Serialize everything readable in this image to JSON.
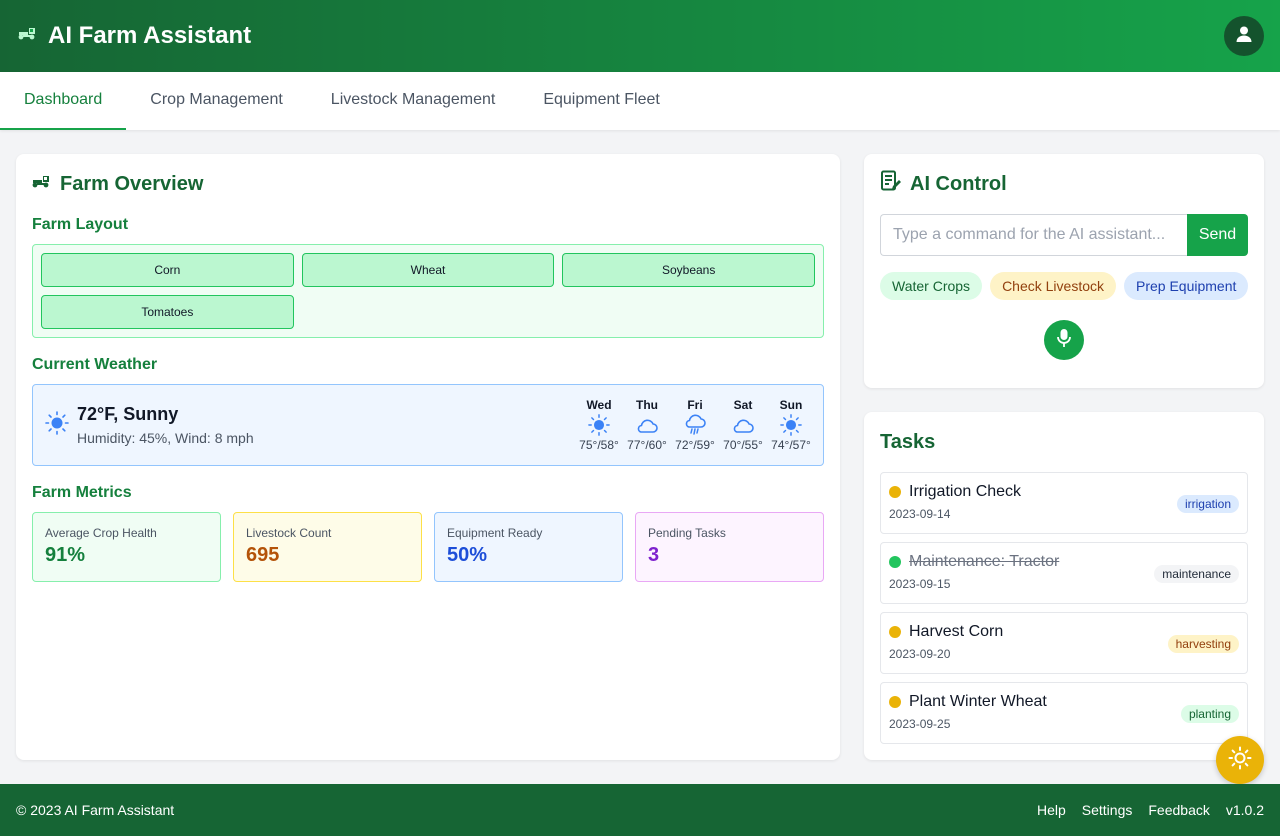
{
  "header": {
    "title": "AI Farm Assistant",
    "logo_icon": "tractor-icon",
    "profile_icon": "user-icon"
  },
  "tabs": [
    {
      "label": "Dashboard",
      "active": true
    },
    {
      "label": "Crop Management",
      "active": false
    },
    {
      "label": "Livestock Management",
      "active": false
    },
    {
      "label": "Equipment Fleet",
      "active": false
    }
  ],
  "overview": {
    "title": "Farm Overview",
    "layout_title": "Farm Layout",
    "plots": [
      "Corn",
      "Wheat",
      "Soybeans",
      "Tomatoes"
    ],
    "weather_title": "Current Weather",
    "weather": {
      "current": "72°F, Sunny",
      "details": "Humidity: 45%, Wind: 8 mph",
      "icon": "sun-icon",
      "forecast": [
        {
          "day": "Wed",
          "icon": "sun-icon",
          "temps": "75°/58°"
        },
        {
          "day": "Thu",
          "icon": "cloud-icon",
          "temps": "77°/60°"
        },
        {
          "day": "Fri",
          "icon": "rain-icon",
          "temps": "72°/59°"
        },
        {
          "day": "Sat",
          "icon": "cloud-icon",
          "temps": "70°/55°"
        },
        {
          "day": "Sun",
          "icon": "sun-icon",
          "temps": "74°/57°"
        }
      ]
    },
    "metrics_title": "Farm Metrics",
    "metrics": [
      {
        "label": "Average Crop Health",
        "value": "91%"
      },
      {
        "label": "Livestock Count",
        "value": "695"
      },
      {
        "label": "Equipment Ready",
        "value": "50%"
      },
      {
        "label": "Pending Tasks",
        "value": "3"
      }
    ]
  },
  "ai_control": {
    "title": "AI Control",
    "placeholder": "Type a command for the AI assistant...",
    "send_label": "Send",
    "quick_actions": [
      "Water Crops",
      "Check Livestock",
      "Prep Equipment"
    ],
    "mic_icon": "microphone-icon"
  },
  "tasks": {
    "title": "Tasks",
    "items": [
      {
        "name": "Irrigation Check",
        "date": "2023-09-14",
        "tag": "irrigation",
        "status": "pending"
      },
      {
        "name": "Maintenance: Tractor",
        "date": "2023-09-15",
        "tag": "maintenance",
        "status": "completed"
      },
      {
        "name": "Harvest Corn",
        "date": "2023-09-20",
        "tag": "harvesting",
        "status": "pending"
      },
      {
        "name": "Plant Winter Wheat",
        "date": "2023-09-25",
        "tag": "planting",
        "status": "pending"
      }
    ]
  },
  "theme_toggle_icon": "sun-icon",
  "footer": {
    "copyright": "© 2023 AI Farm Assistant",
    "links": [
      "Help",
      "Settings",
      "Feedback"
    ],
    "version": "v1.0.2"
  },
  "colors": {
    "primary": "#16a34a",
    "primary_dark": "#166534",
    "accent": "#eab308"
  }
}
